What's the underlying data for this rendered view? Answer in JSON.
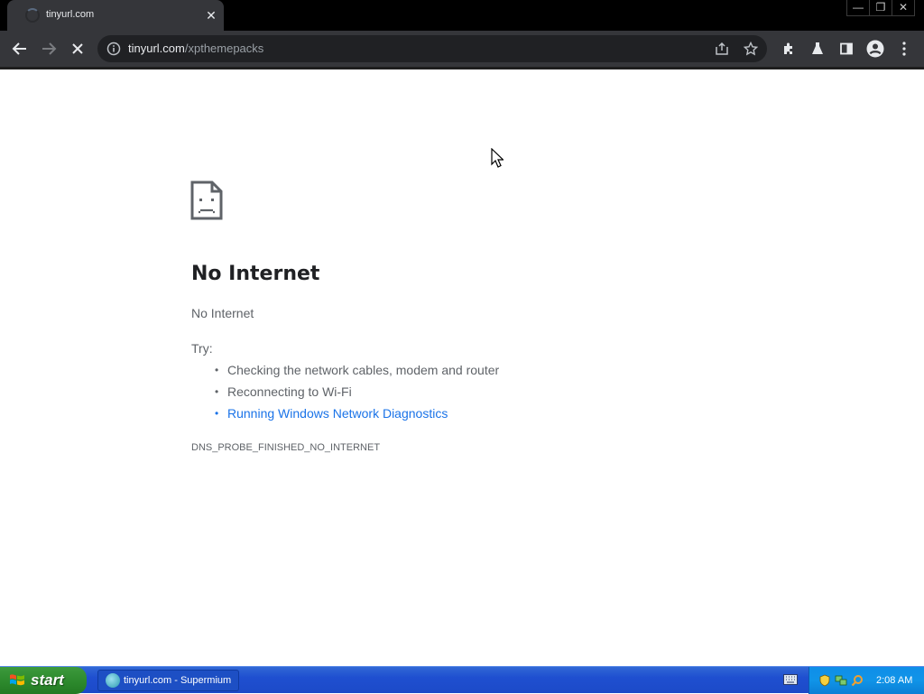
{
  "browser": {
    "tab": {
      "title": "tinyurl.com",
      "close_label": "✕"
    },
    "window_controls": {
      "minimize": "—",
      "restore": "❐",
      "close": "✕"
    },
    "address": {
      "host": "tinyurl.com",
      "path": "/xpthemepacks"
    }
  },
  "page": {
    "title": "No Internet",
    "subtitle": "No Internet",
    "try_label": "Try:",
    "suggestions": [
      "Checking the network cables, modem and router",
      "Reconnecting to Wi-Fi",
      "Running Windows Network Diagnostics"
    ],
    "error_code": "DNS_PROBE_FINISHED_NO_INTERNET"
  },
  "taskbar": {
    "start_label": "start",
    "task_label": "tinyurl.com - Supermium",
    "clock": "2:08 AM"
  },
  "colors": {
    "link": "#1a73e8",
    "text_secondary": "#5f6368",
    "toolbar": "#35363a",
    "taskbar_blue": "#1f4fd0",
    "start_green": "#2e8b2e"
  },
  "icons": {
    "toolbar": [
      "back-icon",
      "forward-icon",
      "stop-icon",
      "info-icon",
      "share-icon",
      "star-icon",
      "extensions-icon",
      "labs-icon",
      "side-panel-icon",
      "profile-icon",
      "menu-icon"
    ],
    "page": "sad-page-icon",
    "tray": [
      "keyboard-icon",
      "security-shield-icon",
      "network-icon",
      "search-icon"
    ]
  }
}
